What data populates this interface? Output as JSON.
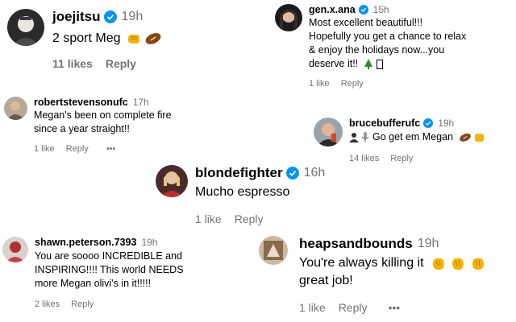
{
  "comments": [
    {
      "username": "joejitsu",
      "verified": true,
      "time": "19h",
      "lines": [
        "2 sport Meg"
      ],
      "emoji": [
        "fist-bump-icon",
        "football-icon"
      ],
      "likes": "11 likes",
      "reply": "Reply",
      "more": ""
    },
    {
      "username": "gen.x.ana",
      "verified": true,
      "time": "15h",
      "lines": [
        "Most excellent beautiful!!!",
        "Hopefully you get a chance to relax",
        "& enjoy the holidays now...you",
        "deserve it!!"
      ],
      "emoji": [
        "christmas-tree-icon",
        "missing-glyph-icon"
      ],
      "likes": "1 like",
      "reply": "Reply",
      "more": ""
    },
    {
      "username": "robertstevensonufc",
      "verified": false,
      "time": "17h",
      "lines": [
        "Megan's been on complete fire",
        "since a year straight!!"
      ],
      "emoji": [],
      "likes": "1 like",
      "reply": "Reply",
      "more": "•••"
    },
    {
      "username": "brucebufferufc",
      "verified": true,
      "time": "19h",
      "lines": [
        "Go get em Megan"
      ],
      "emoji_before": [
        "person-icon",
        "microphone-icon"
      ],
      "emoji": [
        "football-icon",
        "fist-icon"
      ],
      "likes": "14 likes",
      "reply": "Reply",
      "more": ""
    },
    {
      "username": "blondefighter",
      "verified": true,
      "time": "16h",
      "lines": [
        "Mucho espresso"
      ],
      "emoji": [],
      "likes": "1 like",
      "reply": "Reply",
      "more": ""
    },
    {
      "username": "shawn.peterson.7393",
      "verified": false,
      "time": "19h",
      "lines": [
        "You are soooo INCREDIBLE and",
        "INSPIRING!!!! This world NEEDS",
        "more Megan olivi's in it!!!!!"
      ],
      "emoji": [],
      "likes": "2 likes",
      "reply": "Reply",
      "more": ""
    },
    {
      "username": "heapsandbounds",
      "verified": false,
      "time": "19h",
      "lines": [
        "You're always killing it",
        "great job!"
      ],
      "emoji": [
        "clapping-hands-icon",
        "clapping-hands-icon",
        "clapping-hands-icon"
      ],
      "likes": "1 like",
      "reply": "Reply",
      "more": "•••"
    }
  ],
  "colors": {
    "verified": "#0095f6",
    "secondary_text": "#737373",
    "primary_text": "#000000",
    "emoji_yellow": "#f5b400",
    "football_brown": "#8b4513",
    "tree_green": "#2e8b2e"
  }
}
